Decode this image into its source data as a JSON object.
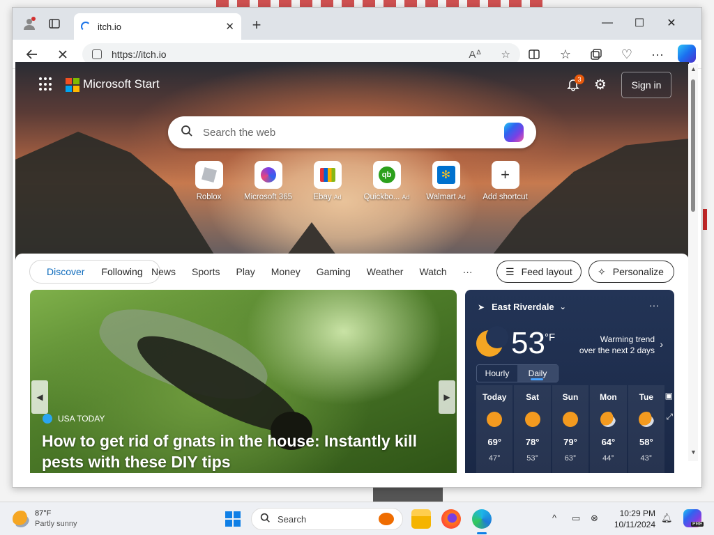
{
  "browser": {
    "tab_title": "itch.io",
    "url": "https://itch.io",
    "new_tab_symbol": "+",
    "tab_close_symbol": "✕"
  },
  "page": {
    "brand": "Microsoft Start",
    "notification_count": "3",
    "sign_in": "Sign in",
    "search_placeholder": "Search the web",
    "shortcuts": [
      {
        "label": "Roblox",
        "ad": ""
      },
      {
        "label": "Microsoft 365",
        "ad": ""
      },
      {
        "label": "Ebay",
        "ad": "Ad"
      },
      {
        "label": "Quickbo...",
        "ad": "Ad"
      },
      {
        "label": "Walmart",
        "ad": "Ad"
      },
      {
        "label": "Add shortcut",
        "ad": ""
      }
    ],
    "feed": {
      "discover": "Discover",
      "following": "Following",
      "nav": [
        "News",
        "Sports",
        "Play",
        "Money",
        "Gaming",
        "Weather",
        "Watch",
        "···"
      ],
      "feed_layout": "Feed layout",
      "personalize": "Personalize"
    },
    "article": {
      "source": "USA TODAY",
      "title": "How to get rid of gnats in the house: Instantly kill pests with these DIY tips"
    },
    "weather": {
      "location": "East Riverdale",
      "temp": "53",
      "unit": "°F",
      "trend_line1": "Warming trend",
      "trend_line2": "over the next 2 days",
      "tab_hourly": "Hourly",
      "tab_daily": "Daily",
      "days": [
        {
          "name": "Today",
          "hi": "69°",
          "lo": "47°",
          "icon": "sun"
        },
        {
          "name": "Sat",
          "hi": "78°",
          "lo": "53°",
          "icon": "sun"
        },
        {
          "name": "Sun",
          "hi": "79°",
          "lo": "63°",
          "icon": "sun"
        },
        {
          "name": "Mon",
          "hi": "64°",
          "lo": "44°",
          "icon": "partly-cloudy"
        },
        {
          "name": "Tue",
          "hi": "58°",
          "lo": "43°",
          "icon": "partly-cloudy"
        }
      ]
    }
  },
  "taskbar": {
    "weather_temp": "87°F",
    "weather_desc": "Partly sunny",
    "search_placeholder": "Search",
    "time": "10:29 PM",
    "date": "10/11/2024",
    "pre_badge": "PRE"
  }
}
